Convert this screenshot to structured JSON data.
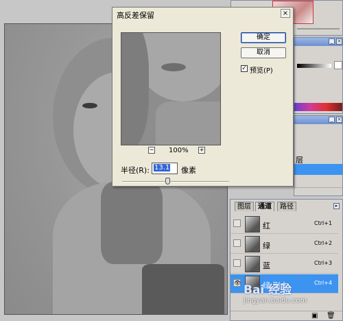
{
  "dialog": {
    "title": "高反差保留",
    "close_glyph": "×",
    "ok_label": "确定",
    "cancel_label": "取消",
    "preview_label": "预览(P)",
    "preview_checked": true,
    "zoom_out": "−",
    "zoom_in": "+",
    "zoom_level": "100%",
    "radius_label": "半径(R):",
    "radius_value": "13.1",
    "radius_unit": "像素"
  },
  "layers_panel": {
    "item_partial": "层",
    "minimize_glyph": "_",
    "close_glyph": "×"
  },
  "channels_panel": {
    "tabs": [
      "图层",
      "通道",
      "路径"
    ],
    "active_tab": "通道",
    "channels": [
      {
        "name": "红",
        "shortcut": "Ctrl+1",
        "selected": false
      },
      {
        "name": "绿",
        "shortcut": "Ctrl+2",
        "selected": false
      },
      {
        "name": "蓝",
        "shortcut": "Ctrl+3",
        "selected": false
      },
      {
        "name": "绿 副本",
        "shortcut": "Ctrl+4",
        "selected": true
      }
    ]
  },
  "watermark": {
    "brand": "Bai 经验",
    "url": "jingyan.baidu.com"
  },
  "colors": {
    "selection_blue": "#3d93f0",
    "dialog_bg": "#ece9d8",
    "panel_bg": "#d6d3ce"
  }
}
